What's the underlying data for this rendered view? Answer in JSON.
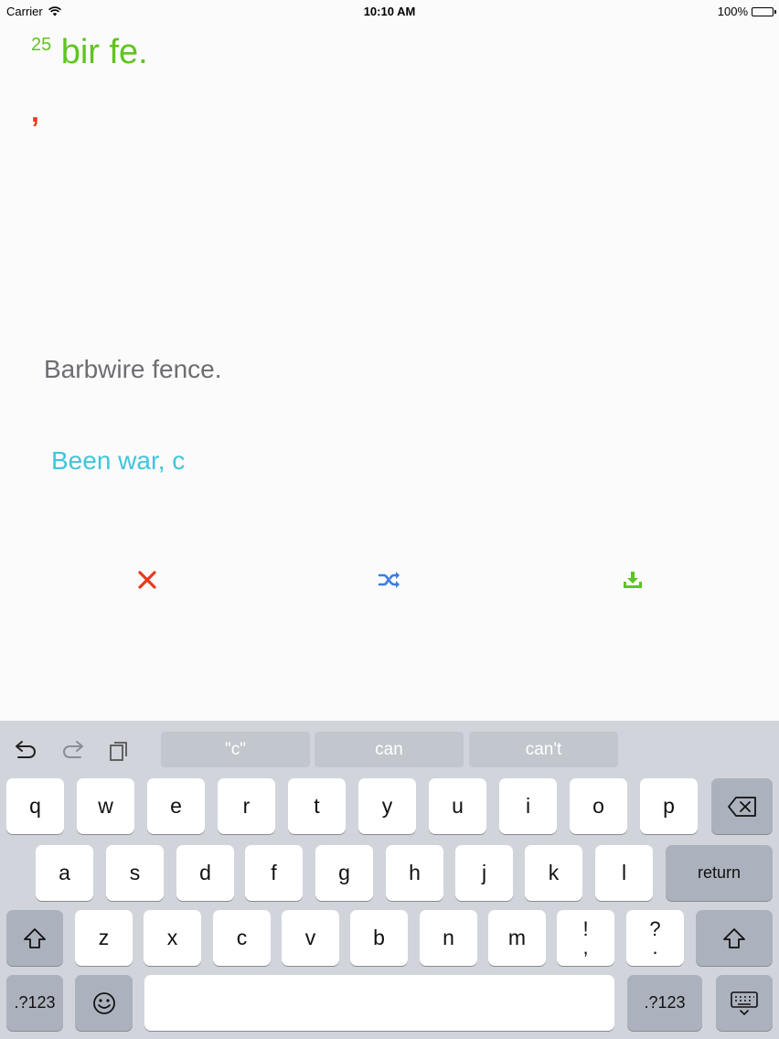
{
  "status_bar": {
    "carrier": "Carrier",
    "time": "10:10 AM",
    "battery": "100%"
  },
  "prompt": {
    "number": "25",
    "text": "bir fe."
  },
  "hint_mark": ",",
  "answer_text": "Barbwire fence.",
  "typed_text": "Been war, c",
  "actions": {
    "close": "close-icon",
    "shuffle": "shuffle-icon",
    "save": "download-icon"
  },
  "colors": {
    "green": "#5fc41f",
    "red": "#e8391d",
    "blue": "#3b7de0",
    "cyan": "#3fc6dc"
  },
  "keyboard": {
    "suggestions": [
      "\"c\"",
      "can",
      "can't"
    ],
    "row1": [
      "q",
      "w",
      "e",
      "r",
      "t",
      "y",
      "u",
      "i",
      "o",
      "p"
    ],
    "row2": [
      "a",
      "s",
      "d",
      "f",
      "g",
      "h",
      "j",
      "k",
      "l"
    ],
    "row3": [
      "z",
      "x",
      "c",
      "v",
      "b",
      "n",
      "m"
    ],
    "punct1": {
      "top": "!",
      "bottom": ","
    },
    "punct2": {
      "top": "?",
      "bottom": "."
    },
    "return_label": "return",
    "numbers_label": ".?123"
  }
}
